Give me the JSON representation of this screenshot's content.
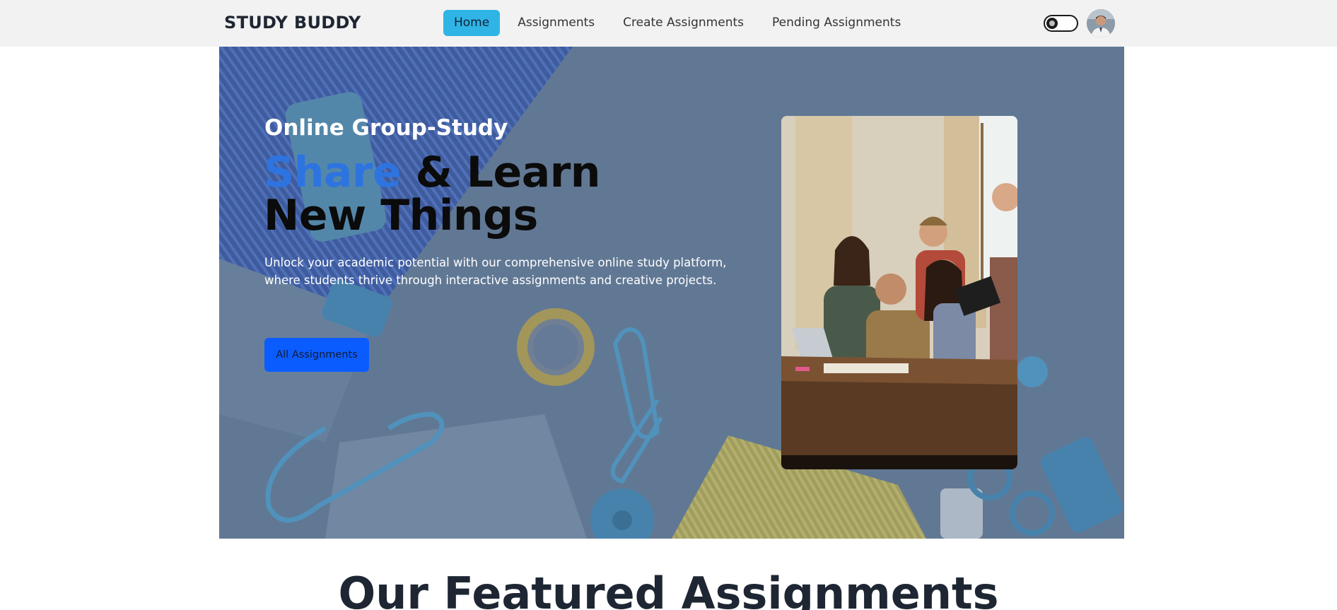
{
  "brand": {
    "name": "STUDY BUDDY"
  },
  "nav": {
    "links": [
      {
        "label": "Home",
        "active": true
      },
      {
        "label": "Assignments",
        "active": false
      },
      {
        "label": "Create Assignments",
        "active": false
      },
      {
        "label": "Pending Assignments",
        "active": false
      }
    ]
  },
  "header": {
    "theme_toggle_icon": "toggle-icon",
    "avatar_icon": "user-avatar"
  },
  "hero": {
    "eyebrow": "Online Group-Study",
    "headline_accent": "Share",
    "headline_rest": " & Learn New Things",
    "description": "Unlock your academic potential with our comprehensive online study platform, where students thrive through interactive assignments and creative projects.",
    "cta_label": "All Assignments",
    "accent_color": "#2d74e0",
    "cta_color": "#0b5cff"
  },
  "featured": {
    "title": "Our Featured Assignments"
  },
  "colors": {
    "nav_active": "#2fb4e5",
    "navbar_bg": "#f2f2f2"
  }
}
